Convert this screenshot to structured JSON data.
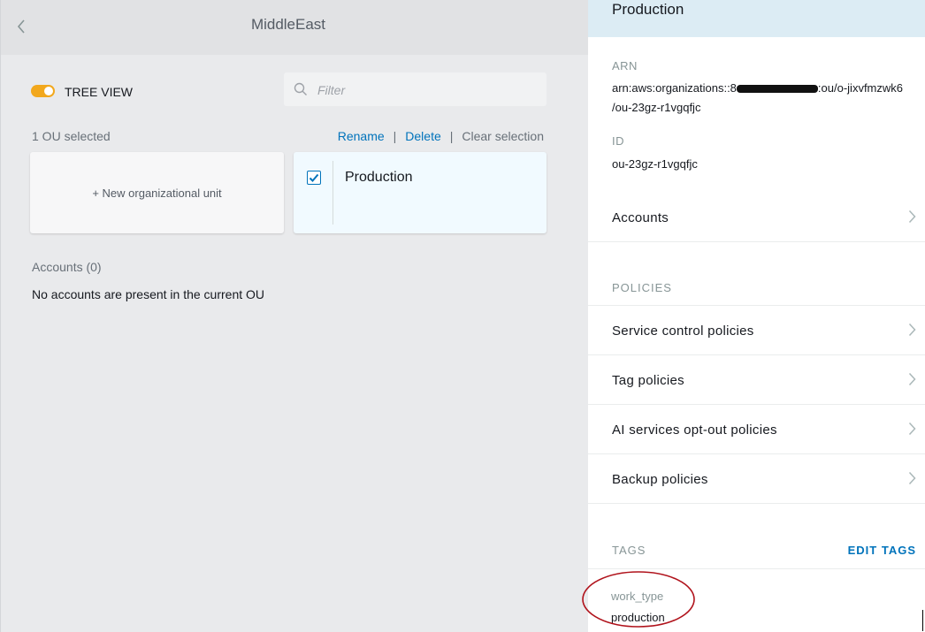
{
  "header": {
    "title": "MiddleEast"
  },
  "toolbar": {
    "tree_view_label": "TREE VIEW",
    "tree_view_on": true,
    "filter_placeholder": "Filter",
    "filter_value": ""
  },
  "selection": {
    "count_label": "1 OU selected",
    "rename": "Rename",
    "delete": "Delete",
    "clear": "Clear selection",
    "separator": "|"
  },
  "cards": {
    "new_ou": "+ New organizational unit",
    "ou_name": "Production",
    "ou_checked": true
  },
  "accounts": {
    "heading": "Accounts (0)",
    "empty_message": "No accounts are present in the current OU"
  },
  "details": {
    "title": "Production",
    "arn_label": "ARN",
    "arn_prefix": "arn:aws:organizations::8",
    "arn_suffix": ":ou/o-jixvfmzwk6",
    "arn_line2": "/ou-23gz-r1vgqfjc",
    "id_label": "ID",
    "id_value": "ou-23gz-r1vgqfjc",
    "accounts_link": "Accounts",
    "policies_title": "POLICIES",
    "policies": [
      {
        "label": "Service control policies"
      },
      {
        "label": "Tag policies"
      },
      {
        "label": "AI services opt-out policies"
      },
      {
        "label": "Backup policies"
      }
    ],
    "tags_title": "TAGS",
    "edit_tags": "EDIT TAGS",
    "tags": [
      {
        "key": "work_type",
        "value": "production"
      }
    ]
  },
  "colors": {
    "accent": "#0073bb",
    "toggle": "#f2a81d",
    "annotation": "#b0121b"
  },
  "icons": [
    "chevron-left-icon",
    "search-icon",
    "checkmark-icon",
    "chevron-right-icon"
  ]
}
